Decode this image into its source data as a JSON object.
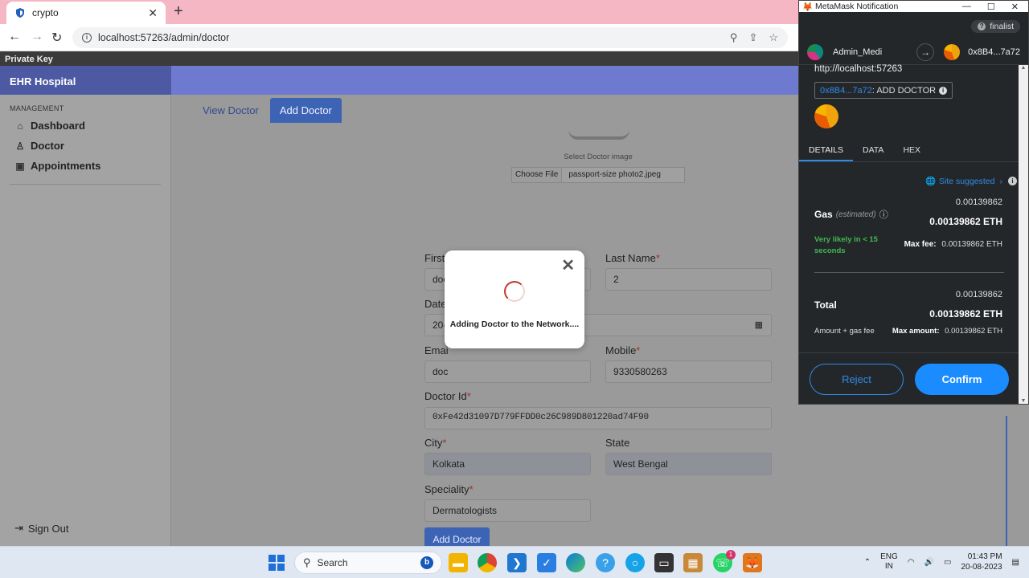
{
  "browser": {
    "tab_title": "crypto",
    "tab_close": "✕",
    "new_tab": "+",
    "url": "localhost:57263/admin/doctor",
    "bookmark": "Private Key"
  },
  "app": {
    "brand": "EHR Hospital",
    "sidebar": {
      "section": "MANAGEMENT",
      "items": [
        {
          "label": "Dashboard",
          "icon": "home-icon"
        },
        {
          "label": "Doctor",
          "icon": "user-icon"
        },
        {
          "label": "Appointments",
          "icon": "calendar-icon"
        }
      ],
      "signout": "Sign Out"
    },
    "tabs": {
      "view": "View Doctor",
      "add": "Add Doctor"
    },
    "form": {
      "image_label": "Select Doctor image",
      "choose_file": "Choose File",
      "file_name": "passport-size photo2.jpeg",
      "first_name_label": "First Name",
      "first_name_value": "doctor",
      "last_name_label": "Last Name",
      "last_name_value": "2",
      "date_label": "Date",
      "date_value": "20-",
      "email_label": "Emai",
      "email_value": "doc",
      "mobile_label": "Mobile",
      "mobile_value": "9330580263",
      "doctor_id_label": "Doctor Id",
      "doctor_id_value": "0xFe42d31097D779FFDD0c26C989D801220ad74F90",
      "city_label": "City",
      "city_value": "Kolkata",
      "state_label": "State",
      "state_value": "West Bengal",
      "speciality_label": "Speciality",
      "speciality_value": "Dermatologists",
      "required_mark": "*",
      "submit": "Add Doctor"
    },
    "modal": {
      "close": "✕",
      "text": "Adding Doctor to the Network...."
    }
  },
  "metamask": {
    "window_title": "MetaMask Notification",
    "network": "finalist",
    "account_name": "Admin_Medi",
    "to_address": "0x8B4...7a72",
    "origin": "http://localhost:57263",
    "method_address": "0x8B4...7a72",
    "method": ": ADD DOCTOR",
    "tabs": [
      "DETAILS",
      "DATA",
      "HEX"
    ],
    "site_suggested": "Site suggested",
    "gas_label": "Gas",
    "gas_estimated": "(estimated)",
    "gas_value_top": "0.00139862",
    "gas_value": "0.00139862 ETH",
    "likely": "Very likely in < 15 seconds",
    "max_fee_label": "Max fee:",
    "max_fee_value": "0.00139862 ETH",
    "total_label": "Total",
    "total_value_top": "0.00139862",
    "total_value": "0.00139862 ETH",
    "amount_gas_fee": "Amount + gas fee",
    "max_amount_label": "Max amount:",
    "max_amount_value": "0.00139862 ETH",
    "reject": "Reject",
    "confirm": "Confirm"
  },
  "taskbar": {
    "search": "Search",
    "lang_1": "ENG",
    "lang_2": "IN",
    "time": "01:43 PM",
    "date": "20-08-2023",
    "badge": "1"
  },
  "colors": {
    "brand_sidebar": "#4d5aa3",
    "topbar": "#6d7ad0",
    "primary_button": "#3d64b4",
    "metamask_bg": "#24272a",
    "metamask_blue": "#1a8cff"
  }
}
